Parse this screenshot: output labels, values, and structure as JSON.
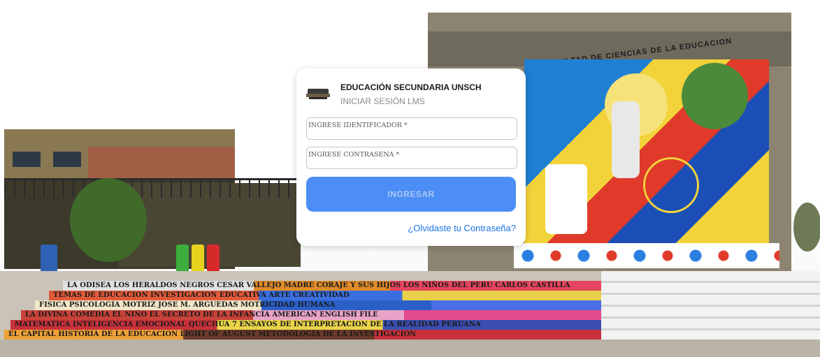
{
  "login": {
    "title": "EDUCACIÓN SECUNDARIA UNSCH",
    "subtitle": "INICIAR SESIÓN LMS",
    "identifier_placeholder": "INGRESE IDENTIFICADOR *",
    "password_placeholder": "INGRESE CONTRASENA *",
    "submit_label": "INGRESAR",
    "forgot_label": "¿Olvidaste tu Contraseña?"
  },
  "background": {
    "mural_title": "ULTAD DE CIENCIAS DE LA EDUCACION",
    "steps": [
      "LA ODISEA   LOS HERALDOS NEGROS   CESAR VALLEJO   MADRE CORAJE Y SUS HIJOS   LOS NIÑOS DEL PERU   CARLOS CASTILLA",
      "TEMAS DE EDUCACION   INVESTIGACION EDUCATIVA   ARTE CREATIVIDAD",
      "FISICA   PSICOLOGIA MOTRIZ   JOSE M. ARGUEDAS   MOTRICIDAD HUMANA",
      "LA DIVINA COMEDIA   EL NIÑO EL SECRETO DE LA INFANCIA   AMERICAN ENGLISH FILE",
      "MATEMATICA   INTELIGENCIA EMOCIONAL   QUECHUA   7 ENSAYOS DE INTERPRETACION DE LA REALIDAD PERUANA",
      "EL CAPITAL   HISTORIA DE LA EDUCACION   LIGHT OF AUGUST   METODOLOGIA DE LA INVESTIGACION"
    ]
  },
  "colors": {
    "accent": "#4c8ef5",
    "link": "#1a73e8"
  }
}
